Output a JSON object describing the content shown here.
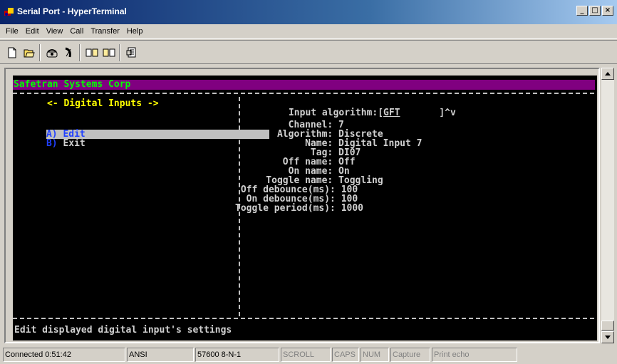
{
  "window": {
    "title": "Serial Port - HyperTerminal"
  },
  "menu": [
    "File",
    "Edit",
    "View",
    "Call",
    "Transfer",
    "Help"
  ],
  "toolbar": [
    "new-connection-icon",
    "open-icon",
    "connect-icon",
    "disconnect-icon",
    "send-icon",
    "receive-icon",
    "properties-icon"
  ],
  "terminal": {
    "banner": "Safetran Systems Corp",
    "left_title": "<- Digital Inputs ->",
    "menu_items": [
      {
        "key": "A)",
        "label": " Edit"
      },
      {
        "key": "B)",
        "label": " Exit"
      }
    ],
    "input_algorithm_label": "Input algorithm:[",
    "input_algorithm_value": "GFT",
    "input_algorithm_close": "]^v",
    "fields": [
      "        Channel: 7",
      "      Algorithm: Discrete",
      "           Name: Digital Input 7",
      "            Tag: DI07",
      "       Off name: Off",
      "        On name: On",
      "    Toggle name: Toggling",
      " Off debounce(ms): 100",
      "  On debounce(ms): 100",
      "Toggle period(ms): 1000"
    ],
    "status_line": "Edit displayed digital input's settings"
  },
  "statusbar": {
    "connected": "Connected 0:51:42",
    "emulation": "ANSI",
    "settings": "57600 8-N-1",
    "scroll": "SCROLL",
    "caps": "CAPS",
    "num": "NUM",
    "capture": "Capture",
    "print_echo": "Print echo"
  }
}
